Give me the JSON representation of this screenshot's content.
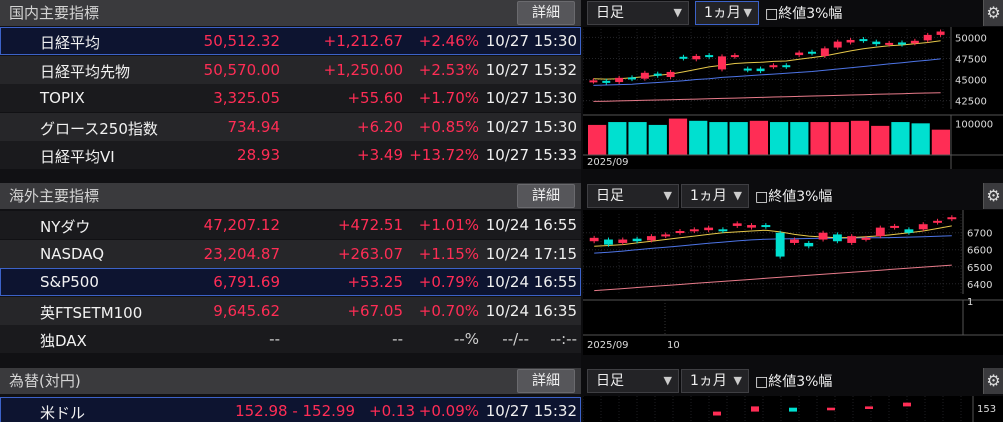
{
  "domestic": {
    "title": "国内主要指標",
    "detail_label": "詳細",
    "rows": [
      {
        "name": "日経平均",
        "price": "50,512.32",
        "change": "+1,212.67",
        "pct": "+2.46%",
        "date": "10/27",
        "time": "15:30"
      },
      {
        "name": "日経平均先物",
        "price": "50,570.00",
        "change": "+1,250.00",
        "pct": "+2.53%",
        "date": "10/27",
        "time": "15:32"
      },
      {
        "name": "TOPIX",
        "price": "3,325.05",
        "change": "+55.60",
        "pct": "+1.70%",
        "date": "10/27",
        "time": "15:30"
      },
      {
        "name": "グロース250指数",
        "price": "734.94",
        "change": "+6.20",
        "pct": "+0.85%",
        "date": "10/27",
        "time": "15:30"
      },
      {
        "name": "日経平均VI",
        "price": "28.93",
        "change": "+3.49",
        "pct": "+13.72%",
        "date": "10/27",
        "time": "15:33"
      }
    ]
  },
  "overseas": {
    "title": "海外主要指標",
    "detail_label": "詳細",
    "rows": [
      {
        "name": "NYダウ",
        "price": "47,207.12",
        "change": "+472.51",
        "pct": "+1.01%",
        "date": "10/24",
        "time": "16:55"
      },
      {
        "name": "NASDAQ",
        "price": "23,204.87",
        "change": "+263.07",
        "pct": "+1.15%",
        "date": "10/24",
        "time": "17:15"
      },
      {
        "name": "S&P500",
        "price": "6,791.69",
        "change": "+53.25",
        "pct": "+0.79%",
        "date": "10/24",
        "time": "16:55"
      },
      {
        "name": "英FTSETM100",
        "price": "9,645.62",
        "change": "+67.05",
        "pct": "+0.70%",
        "date": "10/24",
        "time": "16:35"
      },
      {
        "name": "独DAX",
        "price": "--",
        "change": "--",
        "pct": "--%",
        "date": "--/--",
        "time": "--:--"
      }
    ]
  },
  "fx": {
    "title": "為替(対円)",
    "detail_label": "詳細",
    "rows": [
      {
        "name": "米ドル",
        "price": "152.98 - 152.99",
        "change": "+0.13",
        "pct": "+0.09%",
        "date": "10/27",
        "time": "15:32"
      }
    ]
  },
  "chart_controls": {
    "period_type": "日足",
    "range": "1ヵ月",
    "range_alt": "1ヵ月",
    "checkbox_label": "□終値3%幅"
  },
  "colors": {
    "up": "#ff2d55",
    "down": "#00e0d0",
    "selected_border": "#3c62c8"
  },
  "chart_data": [
    {
      "type": "candlestick",
      "series_main": "日経平均",
      "x_label": "2025/09",
      "y_ticks": [
        "50000",
        "47500",
        "45000",
        "42500"
      ],
      "volume_tick": "100000",
      "ylim": [
        41500,
        51000
      ],
      "candles": [
        {
          "o": 44750,
          "c": 44900
        },
        {
          "o": 44850,
          "c": 44600
        },
        {
          "o": 44700,
          "c": 45200
        },
        {
          "o": 45250,
          "c": 45050
        },
        {
          "o": 45100,
          "c": 45800
        },
        {
          "o": 45700,
          "c": 45450
        },
        {
          "o": 45300,
          "c": 45900
        },
        {
          "o": 47700,
          "c": 47500
        },
        {
          "o": 47400,
          "c": 47800
        },
        {
          "o": 47900,
          "c": 47700
        },
        {
          "o": 46200,
          "c": 47750
        },
        {
          "o": 47700,
          "c": 47900
        },
        {
          "o": 46300,
          "c": 46100
        },
        {
          "o": 46300,
          "c": 46000
        },
        {
          "o": 46500,
          "c": 46700
        },
        {
          "o": 46700,
          "c": 46500
        },
        {
          "o": 47900,
          "c": 48200
        },
        {
          "o": 48300,
          "c": 48100
        },
        {
          "o": 47800,
          "c": 48700
        },
        {
          "o": 48800,
          "c": 49500
        },
        {
          "o": 49400,
          "c": 49700
        },
        {
          "o": 49800,
          "c": 49600
        },
        {
          "o": 49500,
          "c": 49200
        },
        {
          "o": 49150,
          "c": 49350
        },
        {
          "o": 49400,
          "c": 49150
        },
        {
          "o": 49300,
          "c": 49600
        },
        {
          "o": 49650,
          "c": 50300
        },
        {
          "o": 50300,
          "c": 50700
        }
      ],
      "ma_short": [
        45100,
        45050,
        45100,
        45200,
        45350,
        45500,
        45650,
        45900,
        46200,
        46500,
        46700,
        46900,
        47000,
        47050,
        47150,
        47200,
        47400,
        47600,
        47800,
        48100,
        48400,
        48650,
        48850,
        49000,
        49100,
        49250,
        49400,
        49600
      ],
      "ma_mid": [
        44300,
        44350,
        44400,
        44450,
        44550,
        44650,
        44750,
        44850,
        45000,
        45100,
        45250,
        45350,
        45450,
        45550,
        45650,
        45750,
        45850,
        45950,
        46100,
        46250,
        46400,
        46550,
        46700,
        46850,
        47000,
        47150,
        47300,
        47450
      ],
      "ma_long": [
        42400,
        42430,
        42460,
        42500,
        42530,
        42570,
        42600,
        42640,
        42680,
        42720,
        42760,
        42800,
        42840,
        42880,
        42920,
        42960,
        43000,
        43040,
        43080,
        43120,
        43160,
        43200,
        43240,
        43280,
        43320,
        43360,
        43400,
        43440
      ],
      "volumes": [
        {
          "v": 95000,
          "up": true
        },
        {
          "v": 104000,
          "up": false
        },
        {
          "v": 104000,
          "up": false
        },
        {
          "v": 95000,
          "up": false
        },
        {
          "v": 115000,
          "up": true
        },
        {
          "v": 108000,
          "up": false
        },
        {
          "v": 104000,
          "up": false
        },
        {
          "v": 104000,
          "up": false
        },
        {
          "v": 108000,
          "up": true
        },
        {
          "v": 104000,
          "up": false
        },
        {
          "v": 104000,
          "up": false
        },
        {
          "v": 104000,
          "up": true
        },
        {
          "v": 104000,
          "up": true
        },
        {
          "v": 108000,
          "up": true
        },
        {
          "v": 92000,
          "up": true
        },
        {
          "v": 104000,
          "up": false
        },
        {
          "v": 100000,
          "up": false
        },
        {
          "v": 80000,
          "up": true
        }
      ],
      "vlim": [
        0,
        120000
      ]
    },
    {
      "type": "candlestick",
      "series_main": "S&P500",
      "x_label": "2025/09",
      "x_label_2": "10",
      "y_ticks": [
        "6700",
        "6600",
        "6500",
        "6400"
      ],
      "volume_tick": "1",
      "ylim": [
        6340,
        6810
      ],
      "candles": [
        {
          "o": 6650,
          "c": 6670
        },
        {
          "o": 6660,
          "c": 6630
        },
        {
          "o": 6640,
          "c": 6660
        },
        {
          "o": 6665,
          "c": 6650
        },
        {
          "o": 6655,
          "c": 6680
        },
        {
          "o": 6680,
          "c": 6690
        },
        {
          "o": 6700,
          "c": 6710
        },
        {
          "o": 6710,
          "c": 6720
        },
        {
          "o": 6715,
          "c": 6730
        },
        {
          "o": 6720,
          "c": 6710
        },
        {
          "o": 6740,
          "c": 6755
        },
        {
          "o": 6730,
          "c": 6745
        },
        {
          "o": 6745,
          "c": 6735
        },
        {
          "o": 6700,
          "c": 6560
        },
        {
          "o": 6640,
          "c": 6660
        },
        {
          "o": 6640,
          "c": 6620
        },
        {
          "o": 6660,
          "c": 6700
        },
        {
          "o": 6690,
          "c": 6650
        },
        {
          "o": 6640,
          "c": 6680
        },
        {
          "o": 6660,
          "c": 6670
        },
        {
          "o": 6680,
          "c": 6730
        },
        {
          "o": 6730,
          "c": 6740
        },
        {
          "o": 6720,
          "c": 6700
        },
        {
          "o": 6720,
          "c": 6750
        },
        {
          "o": 6760,
          "c": 6770
        },
        {
          "o": 6780,
          "c": 6791
        }
      ],
      "ma_short": [
        6620,
        6625,
        6630,
        6640,
        6650,
        6660,
        6670,
        6680,
        6690,
        6700,
        6705,
        6710,
        6715,
        6705,
        6690,
        6680,
        6675,
        6670,
        6672,
        6676,
        6682,
        6690,
        6700,
        6710,
        6725,
        6740
      ],
      "ma_mid": [
        6580,
        6585,
        6592,
        6600,
        6608,
        6615,
        6622,
        6630,
        6638,
        6645,
        6652,
        6658,
        6662,
        6664,
        6665,
        6666,
        6667,
        6668,
        6669,
        6670,
        6671,
        6672,
        6674,
        6676,
        6679,
        6682
      ],
      "ma_long": [
        6360,
        6366,
        6372,
        6378,
        6384,
        6390,
        6396,
        6402,
        6408,
        6414,
        6420,
        6426,
        6432,
        6438,
        6444,
        6450,
        6456,
        6462,
        6468,
        6474,
        6480,
        6486,
        6492,
        6498,
        6504,
        6510
      ]
    },
    {
      "type": "candlestick",
      "series_main": "米ドル",
      "y_ticks": [
        "153"
      ],
      "ylim": [
        151.5,
        153.5
      ],
      "candles": [
        {
          "o": 152.0,
          "c": 152.3
        },
        {
          "o": 152.3,
          "c": 152.7
        },
        {
          "o": 152.6,
          "c": 152.3
        },
        {
          "o": 152.4,
          "c": 152.6
        },
        {
          "o": 152.5,
          "c": 152.7
        },
        {
          "o": 152.7,
          "c": 152.99
        }
      ]
    }
  ]
}
